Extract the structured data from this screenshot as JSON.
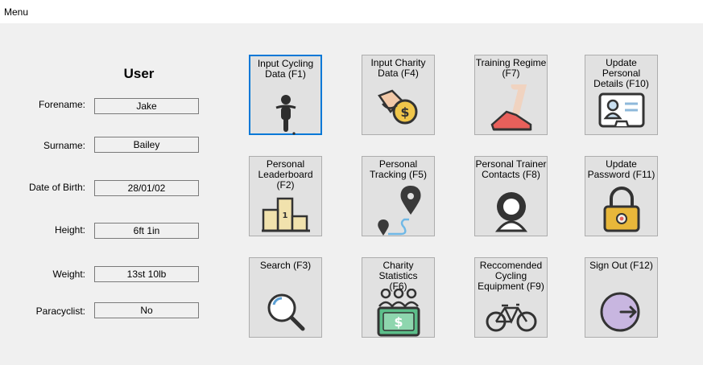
{
  "menubar": {
    "menu_label": "Menu"
  },
  "user": {
    "title": "User",
    "fields": [
      {
        "label": "Forename:",
        "value": "Jake"
      },
      {
        "label": "Surname:",
        "value": "Bailey"
      },
      {
        "label": "Date of Birth:",
        "value": "28/01/02"
      },
      {
        "label": "Height:",
        "value": "6ft 1in"
      },
      {
        "label": "Weight:",
        "value": "13st 10lb"
      },
      {
        "label": "Paracyclist:",
        "value": "No"
      }
    ]
  },
  "tiles": [
    {
      "line1": "Input Cycling",
      "line2": "Data (F1)",
      "line3": "",
      "icon": "cyclist-icon"
    },
    {
      "line1": "Input Charity",
      "line2": "Data (F4)",
      "line3": "",
      "icon": "donate-coin-icon"
    },
    {
      "line1": "Training Regime",
      "line2": "(F7)",
      "line3": "",
      "icon": "running-shoe-icon"
    },
    {
      "line1": "Update Personal",
      "line2": "Details (F10)",
      "line3": "",
      "icon": "id-card-icon"
    },
    {
      "line1": "Personal",
      "line2": "Leaderboard",
      "line3": "(F2)",
      "icon": "podium-icon"
    },
    {
      "line1": "Personal",
      "line2": "Tracking (F5)",
      "line3": "",
      "icon": "map-route-icon"
    },
    {
      "line1": "Personal Trainer",
      "line2": "Contacts (F8)",
      "line3": "",
      "icon": "person-icon"
    },
    {
      "line1": "Update",
      "line2": "Password (F11)",
      "line3": "",
      "icon": "padlock-icon"
    },
    {
      "line1": "Search (F3)",
      "line2": "",
      "line3": "",
      "icon": "magnifier-icon"
    },
    {
      "line1": "Charity Statistics",
      "line2": "(F6)",
      "line3": "",
      "icon": "charity-stats-icon"
    },
    {
      "line1": "Reccomended",
      "line2": "Cycling",
      "line3": "Equipment (F9)",
      "icon": "bicycle-icon"
    },
    {
      "line1": "Sign Out (F12)",
      "line2": "",
      "line3": "",
      "icon": "sign-out-icon"
    }
  ],
  "colors": {
    "selection_border": "#0078d7",
    "tile_bg": "#e1e1e1",
    "window_bg": "#f0f0f0"
  }
}
